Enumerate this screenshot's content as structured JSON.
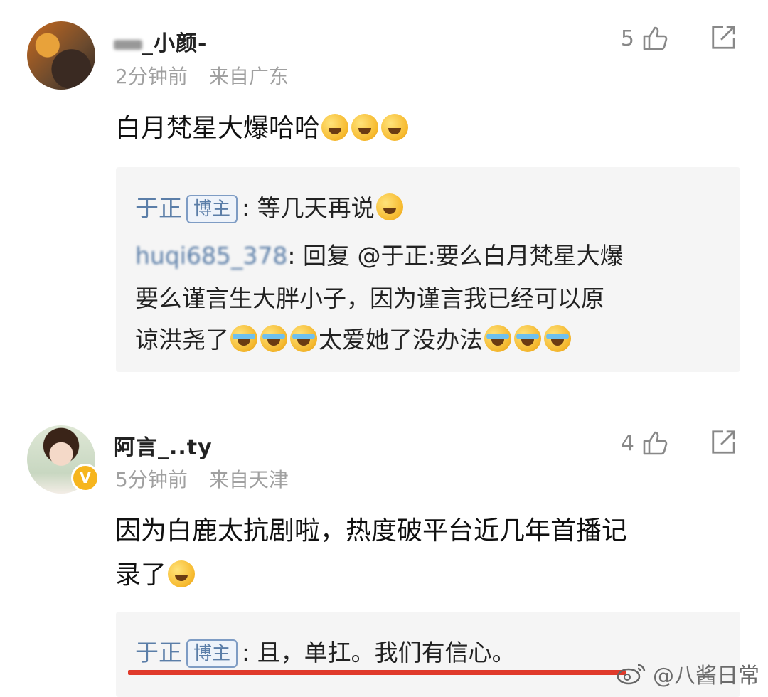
{
  "comments": [
    {
      "username": "_小颜-",
      "time": "2分钟前",
      "location": "来自广东",
      "likes": "5",
      "text": "白月梵星大爆哈哈",
      "reply": {
        "author": "于正",
        "tag": "博主",
        "text": ": 等几天再说",
        "sub_author": "huqi685_378",
        "sub_text_1": ": 回复 @于正:要么白月梵星大爆",
        "sub_text_2": "要么谨言生大胖小子，因为谨言我已经可以原",
        "sub_text_3a": "谅洪尧了",
        "sub_text_3b": "太爱她了没办法"
      }
    },
    {
      "username": "阿言_..ty",
      "time": "5分钟前",
      "location": "来自天津",
      "likes": "4",
      "text_1": "因为白鹿太抗剧啦，热度破平台近几年首播记",
      "text_2": "录了",
      "reply": {
        "author": "于正",
        "tag": "博主",
        "text": ": 且，单扛。我们有信心。"
      }
    }
  ],
  "watermark": "@八酱日常",
  "colors": {
    "link": "#5b7ea8",
    "highlight": "#e03a2b",
    "meta": "#a0a0a0",
    "reply_bg": "#f5f5f5"
  },
  "icons": [
    "thumbs-up-icon",
    "share-icon",
    "verified-badge-icon",
    "weibo-logo-icon"
  ]
}
